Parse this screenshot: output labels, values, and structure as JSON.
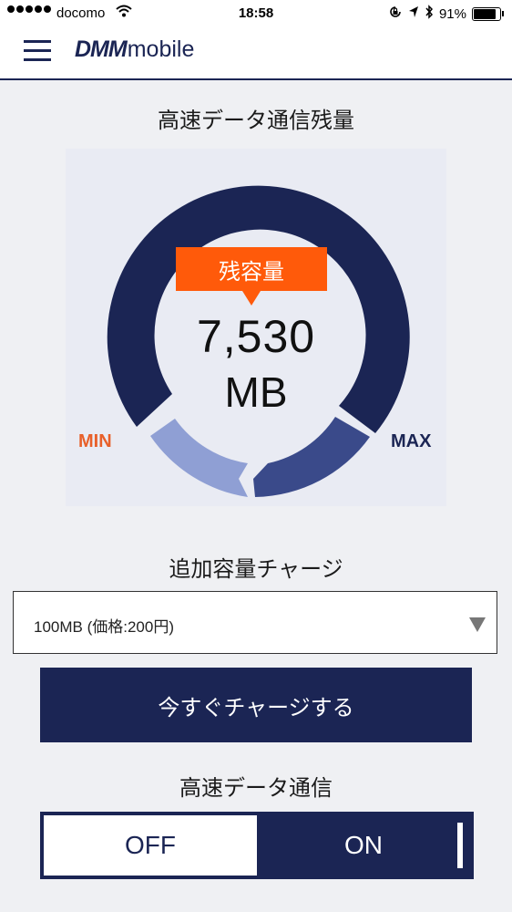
{
  "status_bar": {
    "carrier": "docomo",
    "time": "18:58",
    "battery": "91%",
    "battery_level": 0.91,
    "icons": [
      "signal-dots-icon",
      "wifi-icon",
      "orientation-lock-icon",
      "location-arrow-icon",
      "bluetooth-icon",
      "battery-icon"
    ]
  },
  "header": {
    "logo_brand": "DMM",
    "logo_product": "mobile",
    "menu_icon": "hamburger-menu-icon"
  },
  "data_remaining": {
    "title": "高速データ通信残量",
    "badge": "残容量",
    "amount": "7,530",
    "unit": "MB",
    "min_label": "MIN",
    "max_label": "MAX",
    "colors": {
      "ring": "#1b2554",
      "low": "#8f9fd4",
      "mid": "#3a4a8a",
      "accent": "#ff5a0a"
    }
  },
  "charge": {
    "title": "追加容量チャージ",
    "selected_option": "100MB (価格:200円)",
    "button_label": "今すぐチャージする"
  },
  "high_speed": {
    "title": "高速データ通信",
    "off_label": "OFF",
    "on_label": "ON",
    "state": "OFF"
  }
}
